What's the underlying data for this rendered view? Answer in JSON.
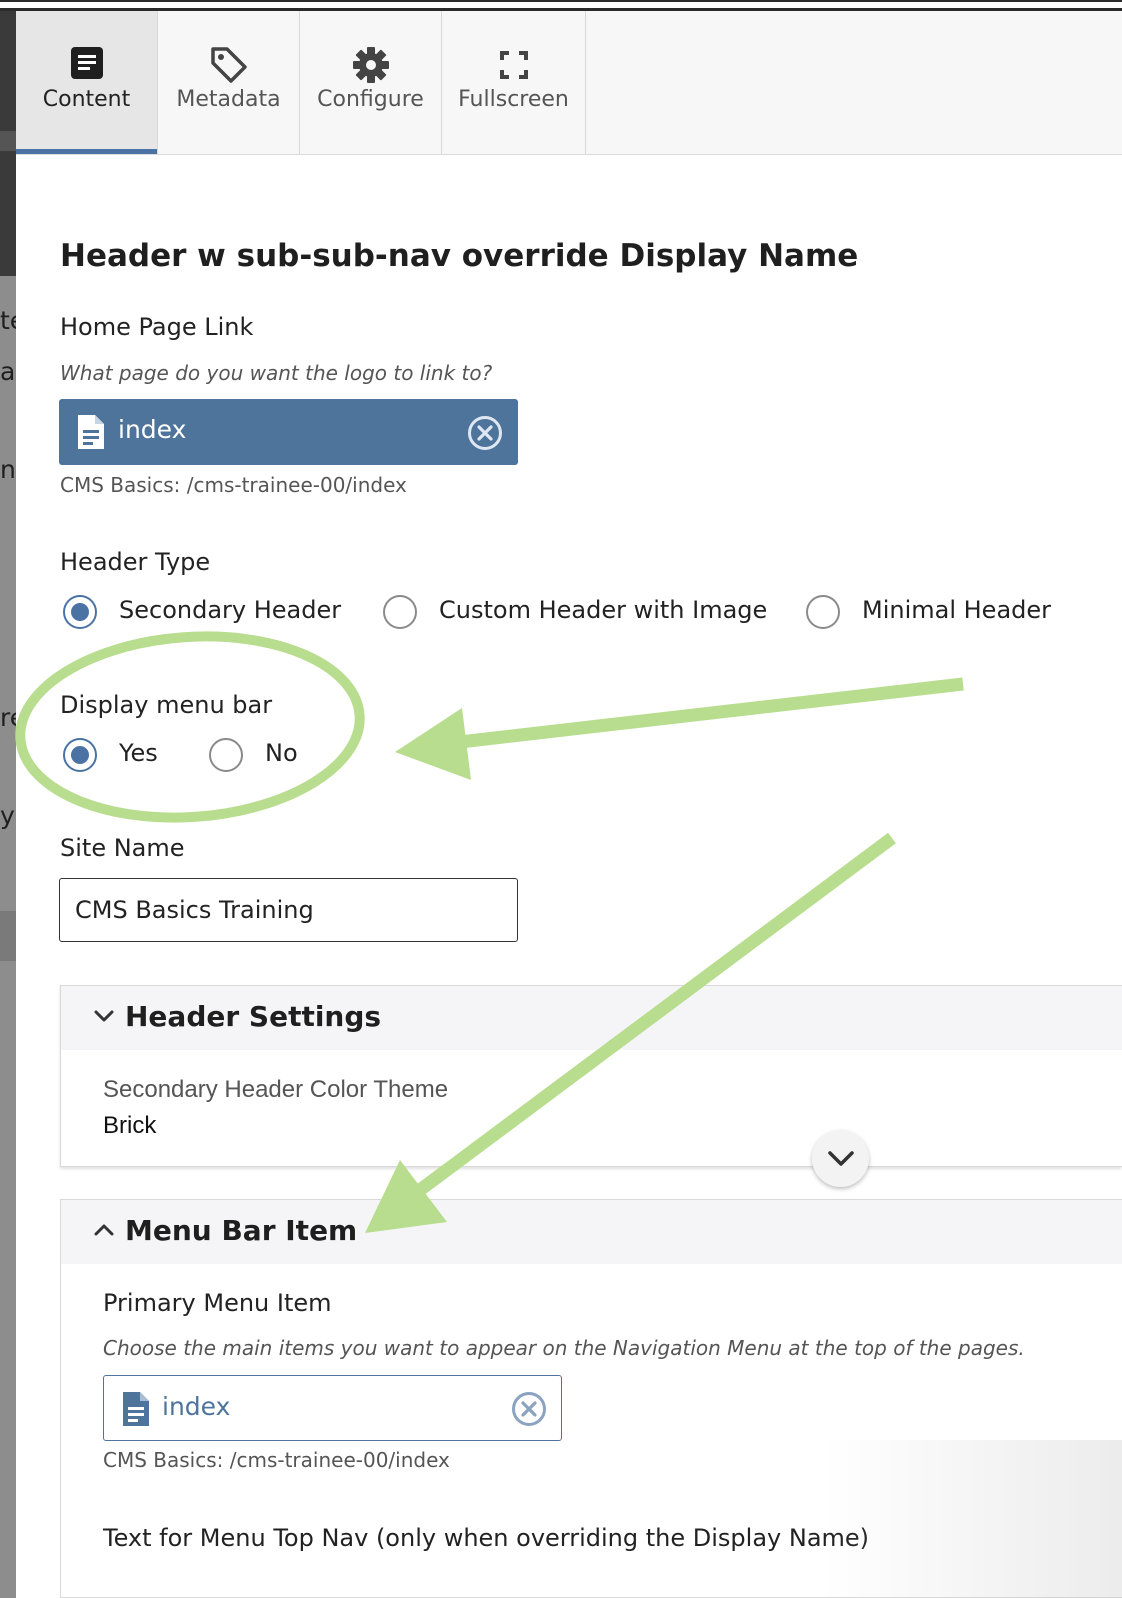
{
  "tabs": [
    {
      "label": "Content",
      "icon": "content-icon",
      "active": true
    },
    {
      "label": "Metadata",
      "icon": "tag-icon",
      "active": false
    },
    {
      "label": "Configure",
      "icon": "gear-icon",
      "active": false
    },
    {
      "label": "Fullscreen",
      "icon": "fullscreen-icon",
      "active": false
    }
  ],
  "left_fragments": [
    "te",
    "ag",
    "n-c",
    "re",
    "y"
  ],
  "form": {
    "title": "Header w sub-sub-nav override Display Name",
    "home_link": {
      "label": "Home Page Link",
      "help": "What page do you want the logo to link to?",
      "value": "index",
      "path": "CMS Basics: /cms-trainee-00/index"
    },
    "header_type": {
      "label": "Header Type",
      "options": [
        {
          "label": "Secondary Header",
          "selected": true
        },
        {
          "label": "Custom Header with Image",
          "selected": false
        },
        {
          "label": "Minimal Header",
          "selected": false
        }
      ]
    },
    "display_menu_bar": {
      "label": "Display menu bar",
      "options": [
        {
          "label": "Yes",
          "selected": true
        },
        {
          "label": "No",
          "selected": false
        }
      ]
    },
    "site_name": {
      "label": "Site Name",
      "value": "CMS Basics Training"
    }
  },
  "header_settings": {
    "title": "Header Settings",
    "expanded": true,
    "color_theme_label": "Secondary Header Color Theme",
    "color_theme_value": "Brick"
  },
  "menu_bar_item": {
    "title": "Menu Bar Item",
    "primary_label": "Primary Menu Item",
    "primary_help": "Choose the main items you want to appear on the Navigation Menu at the top of the pages.",
    "primary_value": "index",
    "primary_path": "CMS Basics: /cms-trainee-00/index",
    "text_override_label": "Text for Menu Top Nav (only when overriding the Display Name)"
  },
  "colors": {
    "accent": "#4a73a4",
    "chip": "#4f749c",
    "annotation": "#b8dd8e"
  }
}
